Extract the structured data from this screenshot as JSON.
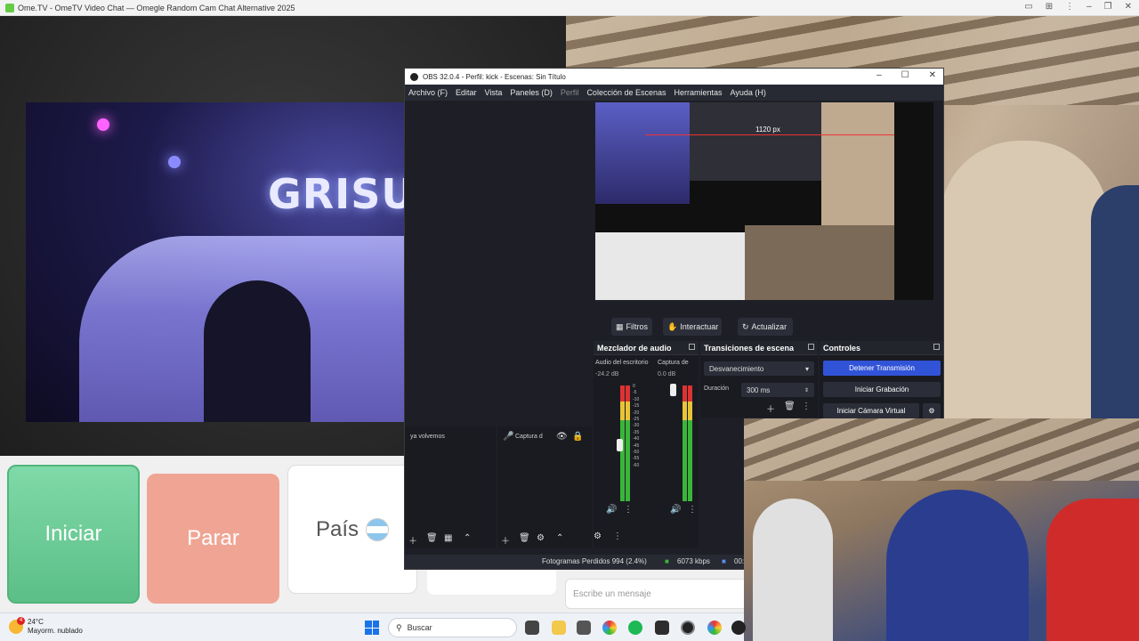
{
  "browser": {
    "title": "Ome.TV - OmeTV Video Chat — Omegle Random Cam Chat Alternative 2025",
    "icons": [
      "screen-share-icon",
      "translate-icon",
      "more-icon",
      "minimize-icon",
      "restore-icon",
      "close-icon"
    ]
  },
  "omegle": {
    "party_sign": "GRISU",
    "start_label": "Iniciar",
    "stop_label": "Parar",
    "country_label": "País",
    "message_placeholder": "Escribe un mensaje",
    "colors": {
      "start": "#6fd39a",
      "stop": "#f0a594"
    }
  },
  "obs": {
    "title": "OBS 32.0.4 - Perfil: kick - Escenas: Sin Título",
    "menu": [
      "Archivo (F)",
      "Editar",
      "Vista",
      "Paneles (D)",
      "Perfil",
      "Colección de Escenas",
      "Herramientas",
      "Ayuda (H)"
    ],
    "preview_label": "1120 px",
    "toolbar": {
      "filters": "Filtros",
      "interact": "Interactuar",
      "refresh": "Actualizar"
    },
    "mixer": {
      "title": "Mezclador de audio",
      "channels": [
        {
          "name": "Audio del escritorio",
          "level": "-24.2 dB"
        },
        {
          "name": "Captura de",
          "level": "0.0 dB"
        }
      ],
      "scale": [
        "0",
        "-5",
        "-10",
        "-15",
        "-20",
        "-25",
        "-30",
        "-35",
        "-40",
        "-45",
        "-50",
        "-55",
        "-60"
      ]
    },
    "transitions": {
      "title": "Transiciones de escena",
      "selected": "Desvanecimiento",
      "duration_label": "Duración",
      "duration_value": "300 ms"
    },
    "controls": {
      "title": "Controles",
      "stop_stream": "Detener Transmisión",
      "start_recording": "Iniciar Grabación",
      "start_virtual_cam": "Iniciar Cámara Virtual"
    },
    "scenes": {
      "item": "ya volvemos"
    },
    "sources": {
      "item": "Captura d"
    },
    "status": {
      "dropped_frames": "Fotogramas Perdidos 994 (2.4%)",
      "bitrate": "6073 kbps",
      "extra": "00:"
    }
  },
  "taskbar": {
    "temperature": "24°C",
    "weather": "Mayorm. nublado",
    "notification_count": "4",
    "search_placeholder": "Buscar"
  }
}
